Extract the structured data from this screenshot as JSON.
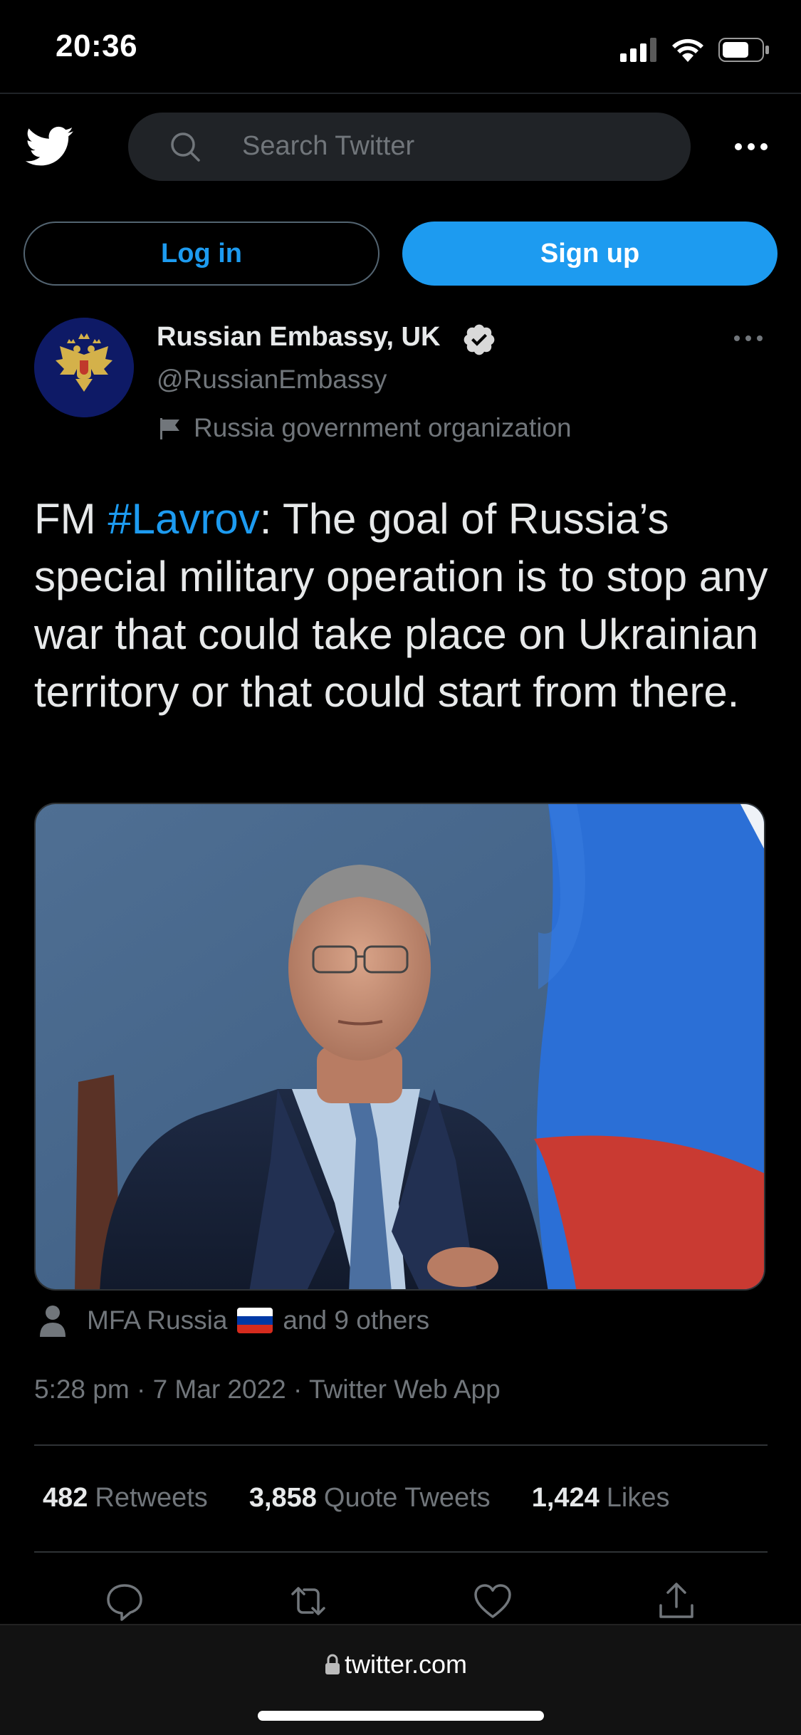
{
  "status_bar": {
    "time": "20:36"
  },
  "nav": {
    "search_placeholder": "Search Twitter"
  },
  "auth": {
    "login_label": "Log in",
    "signup_label": "Sign up"
  },
  "tweet": {
    "author_name": "Russian Embassy, UK",
    "author_handle": "@RussianEmbassy",
    "label": "Russia government organization",
    "text_prefix": "FM ",
    "hashtag": "#Lavrov",
    "text_rest": ": The goal of Russia’s special military operation is to stop any war that could take place on Ukrainian territory or that could start from there.",
    "tagged_primary": "MFA Russia",
    "tagged_rest": "and 9 others",
    "timestamp": "5:28 pm · 7 Mar 2022 · Twitter Web App",
    "stats": {
      "retweets": "482",
      "retweets_label": "Retweets",
      "quotes": "3,858",
      "quotes_label": "Quote Tweets",
      "likes": "1,424",
      "likes_label": "Likes"
    }
  },
  "browser": {
    "url": "twitter.com"
  },
  "colors": {
    "accent": "#1d9bf0",
    "background": "#000000",
    "text_primary": "#e7e9ea",
    "text_secondary": "#71767b",
    "divider": "#2f3336"
  },
  "icons": {
    "logo": "twitter-bird-icon",
    "search": "search-icon",
    "more": "more-horizontal-icon",
    "verified": "verified-badge-icon",
    "label": "flag-icon",
    "reply": "reply-icon",
    "retweet": "retweet-icon",
    "like": "heart-icon",
    "share": "share-icon",
    "lock": "lock-icon"
  }
}
